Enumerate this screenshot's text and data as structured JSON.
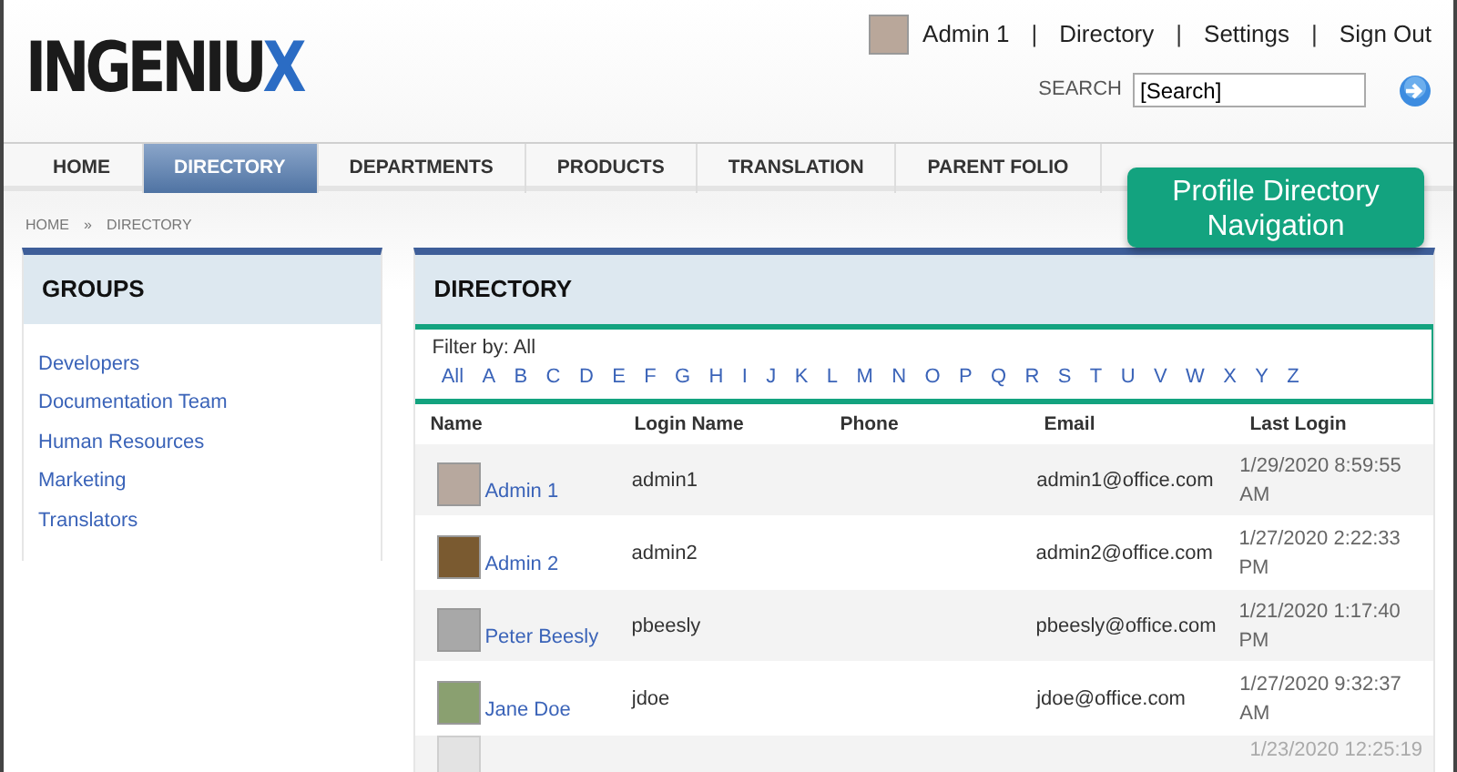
{
  "logo": {
    "text": "INGENIU",
    "accent": "X"
  },
  "top_links": [
    {
      "kind": "user",
      "label": "Admin 1"
    },
    {
      "kind": "separator",
      "label": "|"
    },
    {
      "kind": "link",
      "label": "Directory"
    },
    {
      "kind": "separator",
      "label": "|"
    },
    {
      "kind": "link",
      "label": "Settings"
    },
    {
      "kind": "separator",
      "label": "|"
    },
    {
      "kind": "link",
      "label": "Sign Out"
    }
  ],
  "search": {
    "label": "SEARCH",
    "value": "[Search]"
  },
  "tabs": [
    {
      "label": "HOME",
      "selected": false
    },
    {
      "label": "DIRECTORY",
      "selected": true
    },
    {
      "label": "DEPARTMENTS",
      "selected": false
    },
    {
      "label": "PRODUCTS",
      "selected": false
    },
    {
      "label": "TRANSLATION",
      "selected": false
    },
    {
      "label": "PARENT FOLIO",
      "selected": false
    }
  ],
  "breadcrumb": {
    "items": [
      "HOME",
      "DIRECTORY"
    ],
    "separator": "»"
  },
  "groups": {
    "title": "GROUPS",
    "items": [
      "Developers",
      "Documentation Team",
      "Human Resources",
      "Marketing",
      "Translators"
    ]
  },
  "directory": {
    "title": "DIRECTORY",
    "filter_label": "Filter by: All",
    "letters": [
      "All",
      "A",
      "B",
      "C",
      "D",
      "E",
      "F",
      "G",
      "H",
      "I",
      "J",
      "K",
      "L",
      "M",
      "N",
      "O",
      "P",
      "Q",
      "R",
      "S",
      "T",
      "U",
      "V",
      "W",
      "X",
      "Y",
      "Z"
    ],
    "columns": [
      "Name",
      "Login Name",
      "Phone",
      "Email",
      "Last Login"
    ],
    "rows": [
      {
        "name": "Admin 1",
        "login": "admin1",
        "email": "admin1@office.com",
        "last_login": "1/29/2020 8:59:55 AM"
      },
      {
        "name": "Admin 2",
        "login": "admin2",
        "email": "admin2@office.com",
        "last_login": "1/27/2020 2:22:33 PM"
      },
      {
        "name": "Peter Beesly",
        "login": "pbeesly",
        "email": "pbeesly@office.com",
        "last_login": "1/21/2020 1:17:40 PM"
      },
      {
        "name": "Jane Doe",
        "login": "jdoe",
        "email": "jdoe@office.com",
        "last_login": "1/27/2020 9:32:37 AM"
      },
      {
        "last_login": "1/23/2020 12:25:19"
      }
    ]
  },
  "callout": {
    "text": "Profile Directory Navigation"
  }
}
